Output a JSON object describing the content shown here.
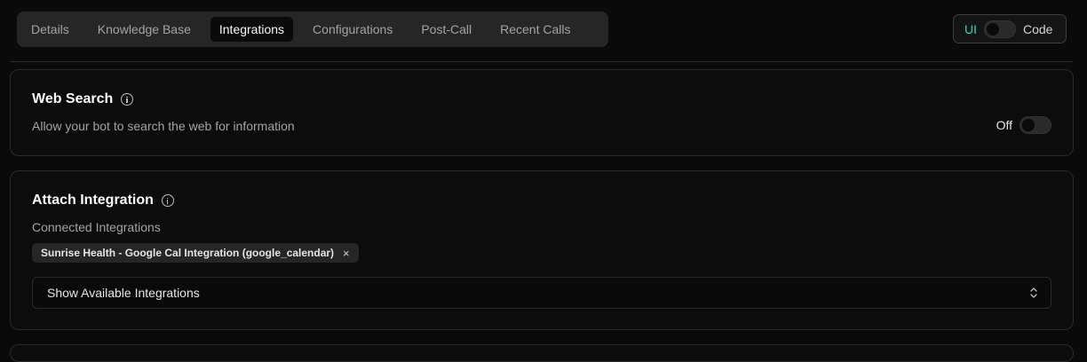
{
  "tabs": [
    {
      "label": "Details",
      "active": false
    },
    {
      "label": "Knowledge Base",
      "active": false
    },
    {
      "label": "Integrations",
      "active": true
    },
    {
      "label": "Configurations",
      "active": false
    },
    {
      "label": "Post-Call",
      "active": false
    },
    {
      "label": "Recent Calls",
      "active": false
    }
  ],
  "mode": {
    "ui_label": "UI",
    "code_label": "Code",
    "selected": "UI"
  },
  "web_search": {
    "title": "Web Search",
    "description": "Allow your bot to search the web for information",
    "state_label": "Off",
    "enabled": false
  },
  "attach_integration": {
    "title": "Attach Integration",
    "connected_label": "Connected Integrations",
    "connected": [
      "Sunrise Health - Google Cal Integration (google_calendar)"
    ],
    "remove_glyph": "×",
    "select_label": "Show Available Integrations"
  },
  "colors": {
    "accent": "#2dd4bf",
    "background": "#0a0a0a"
  }
}
